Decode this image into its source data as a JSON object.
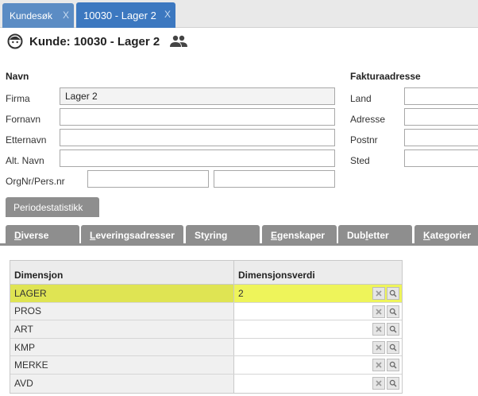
{
  "tabs": [
    {
      "label": "Kundesøk",
      "close": "X"
    },
    {
      "label": "10030 - Lager 2",
      "close": "X"
    }
  ],
  "header": {
    "title": "Kunde: 10030 - Lager 2"
  },
  "name_section": {
    "title": "Navn",
    "fields": [
      {
        "label": "Firma",
        "value": "Lager 2"
      },
      {
        "label": "Fornavn",
        "value": ""
      },
      {
        "label": "Etternavn",
        "value": ""
      },
      {
        "label": "Alt. Navn",
        "value": ""
      },
      {
        "label": "OrgNr/Pers.nr",
        "value": "",
        "value2": ""
      }
    ]
  },
  "invoice_section": {
    "title": "Fakturaadresse",
    "fields": [
      {
        "label": "Land",
        "value": ""
      },
      {
        "label": "Adresse",
        "value": ""
      },
      {
        "label": "Postnr",
        "value": ""
      },
      {
        "label": "Sted",
        "value": ""
      }
    ]
  },
  "period_tab": "Periodestatistikk",
  "subtabs": [
    {
      "key": "D",
      "rest": "iverse"
    },
    {
      "key": "L",
      "rest": "everingsadresser"
    },
    {
      "pre": "St",
      "key": "y",
      "rest": "ring"
    },
    {
      "key": "E",
      "rest": "genskaper"
    },
    {
      "pre": "Dub",
      "key": "l",
      "rest": "etter"
    },
    {
      "key": "K",
      "rest": "ategorier"
    }
  ],
  "grid": {
    "headers": [
      "Dimensjon",
      "Dimensjonsverdi"
    ],
    "rows": [
      {
        "dim": "LAGER",
        "value": "2",
        "selected": true
      },
      {
        "dim": "PROS",
        "value": ""
      },
      {
        "dim": "ART",
        "value": ""
      },
      {
        "dim": "KMP",
        "value": ""
      },
      {
        "dim": "MERKE",
        "value": ""
      },
      {
        "dim": "AVD",
        "value": ""
      }
    ]
  },
  "colors": {
    "tab_active": "#3c78c0",
    "tab_inactive": "#5b8cc4",
    "subtab": "#8e8e8e",
    "selected_row": "#eef45a"
  },
  "icons": [
    "face-icon",
    "group-icon",
    "clear-icon",
    "search-icon"
  ]
}
